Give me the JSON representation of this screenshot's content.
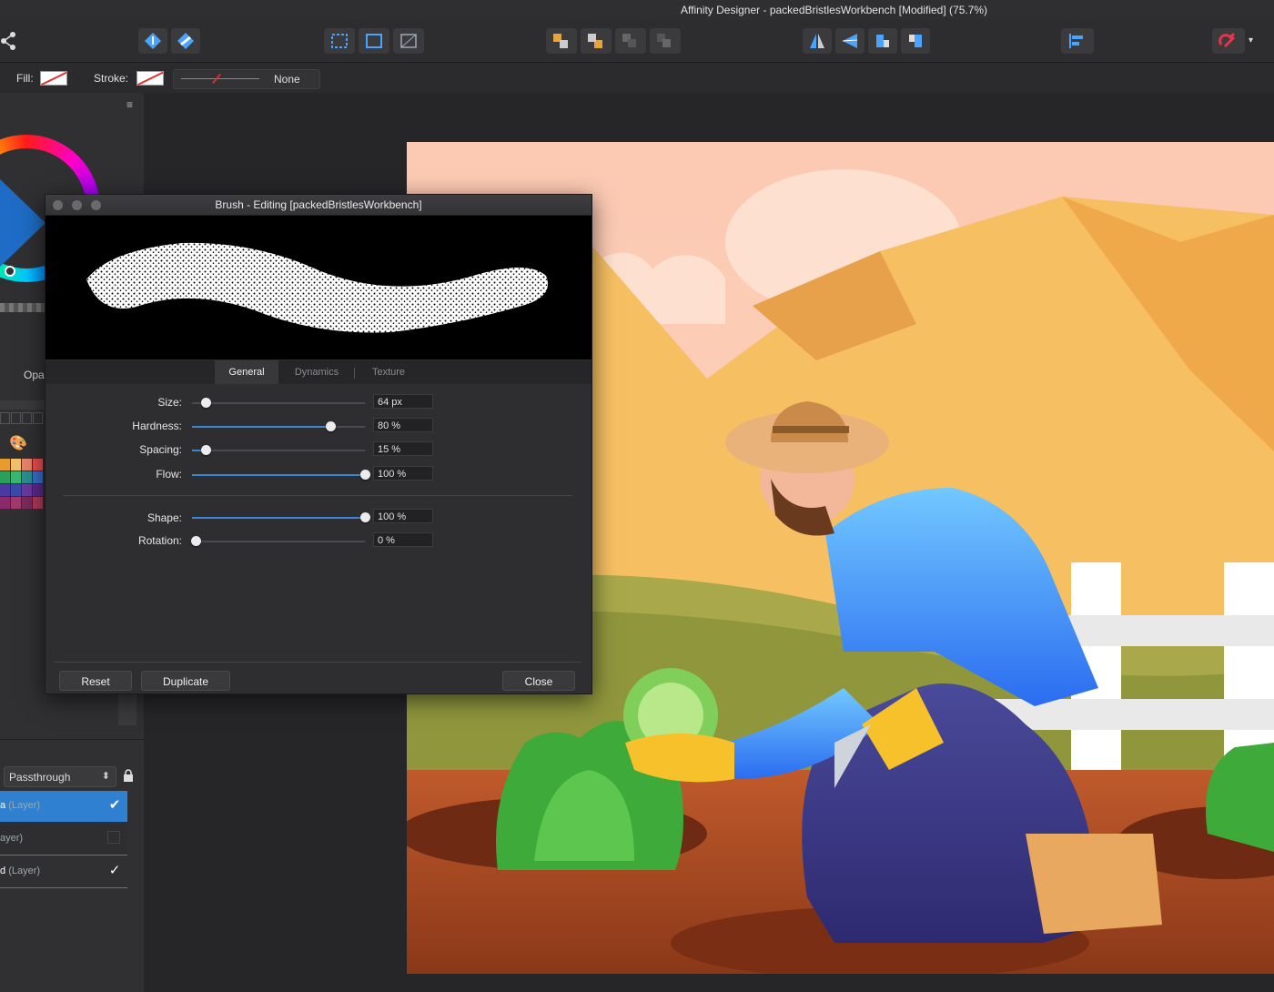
{
  "window": {
    "title": "Affinity Designer - packedBristlesWorkbench [Modified] (75.7%)"
  },
  "context_bar": {
    "fill_label": "Fill:",
    "stroke_label": "Stroke:",
    "stroke_style": "None"
  },
  "left_panel": {
    "menu_glyph": "≡",
    "opacity_label": "Opa",
    "palette_glyph": "🎨"
  },
  "layers": {
    "blend_mode": "Passthrough",
    "rows": [
      {
        "name": "a",
        "type": "(Layer)",
        "checked": "✔"
      },
      {
        "name": "",
        "type": "ayer)",
        "checked": ""
      },
      {
        "name": "d",
        "type": "(Layer)",
        "checked": "✓"
      }
    ]
  },
  "brush_dialog": {
    "title": "Brush - Editing [packedBristlesWorkbench]",
    "tabs": [
      "General",
      "Dynamics",
      "Texture"
    ],
    "active_tab": "General",
    "params": [
      {
        "label": "Size:",
        "value": "64 px",
        "fraction": 0.08,
        "filled": false
      },
      {
        "label": "Hardness:",
        "value": "80 %",
        "fraction": 0.8,
        "filled": true
      },
      {
        "label": "Spacing:",
        "value": "15 %",
        "fraction": 0.08,
        "filled": true
      },
      {
        "label": "Flow:",
        "value": "100 %",
        "fraction": 1.0,
        "filled": true
      },
      {
        "label": "Shape:",
        "value": "100 %",
        "fraction": 1.0,
        "filled": true
      },
      {
        "label": "Rotation:",
        "value": "0 %",
        "fraction": 0.02,
        "filled": false
      }
    ],
    "buttons": {
      "reset": "Reset",
      "duplicate": "Duplicate",
      "close": "Close"
    }
  },
  "colors": {
    "accent": "#3b86d8",
    "selection": "#2f80d0",
    "background": "#2a2a2c"
  }
}
